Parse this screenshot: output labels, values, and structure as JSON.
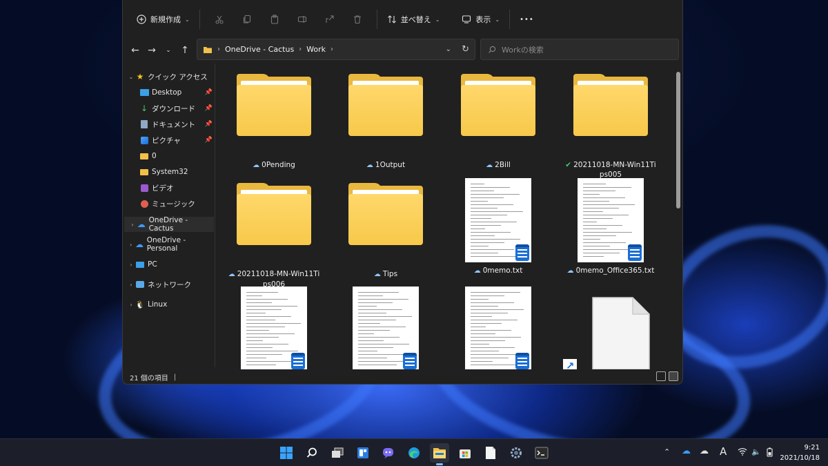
{
  "toolbar": {
    "new_label": "新規作成",
    "sort_label": "並べ替え",
    "view_label": "表示",
    "more_label": "•••"
  },
  "address": {
    "segments": [
      "OneDrive - Cactus",
      "Work"
    ],
    "search_placeholder": "Workの検索"
  },
  "nav": {
    "quick_access": "クイック アクセス",
    "items": [
      {
        "label": "Desktop",
        "icon": "desktop-icon",
        "pinned": true
      },
      {
        "label": "ダウンロード",
        "icon": "download-icon",
        "pinned": true
      },
      {
        "label": "ドキュメント",
        "icon": "document-icon",
        "pinned": true
      },
      {
        "label": "ピクチャ",
        "icon": "pictures-icon",
        "pinned": true
      },
      {
        "label": "0",
        "icon": "folder-icon",
        "pinned": false
      },
      {
        "label": "System32",
        "icon": "folder-icon",
        "pinned": false
      },
      {
        "label": "ビデオ",
        "icon": "video-icon",
        "pinned": false
      },
      {
        "label": "ミュージック",
        "icon": "music-icon",
        "pinned": false
      }
    ],
    "onedrive_cactus": "OneDrive - Cactus",
    "onedrive_personal": "OneDrive - Personal",
    "pc": "PC",
    "network": "ネットワーク",
    "linux": "Linux"
  },
  "files": [
    {
      "name": "0Pending",
      "type": "folder",
      "status": "cloud"
    },
    {
      "name": "1Output",
      "type": "folder",
      "status": "cloud"
    },
    {
      "name": "2Bill",
      "type": "folder",
      "status": "cloud"
    },
    {
      "name": "20211018-MN-Win11Tips005",
      "type": "folder",
      "status": "synced"
    },
    {
      "name": "20211018-MN-Win11Tips006",
      "type": "folder",
      "status": "cloud"
    },
    {
      "name": "Tips",
      "type": "folder",
      "status": "cloud"
    },
    {
      "name": "0memo.txt",
      "type": "text",
      "status": "cloud"
    },
    {
      "name": "0memo_Office365.txt",
      "type": "text",
      "status": "cloud"
    },
    {
      "name": "",
      "type": "text",
      "status": ""
    },
    {
      "name": "",
      "type": "text",
      "status": ""
    },
    {
      "name": "",
      "type": "text",
      "status": ""
    },
    {
      "name": "",
      "type": "shortcut",
      "status": ""
    }
  ],
  "status_bar": {
    "item_count": "21 個の項目"
  },
  "clock": {
    "time": "9:21",
    "date": "2021/10/18"
  },
  "tray": {
    "ime": "A"
  },
  "colors": {
    "folder": "#f7c84a",
    "accent": "#7fb8ff",
    "window_bg": "#202020",
    "taskbar_bg": "#1c1f2a"
  }
}
